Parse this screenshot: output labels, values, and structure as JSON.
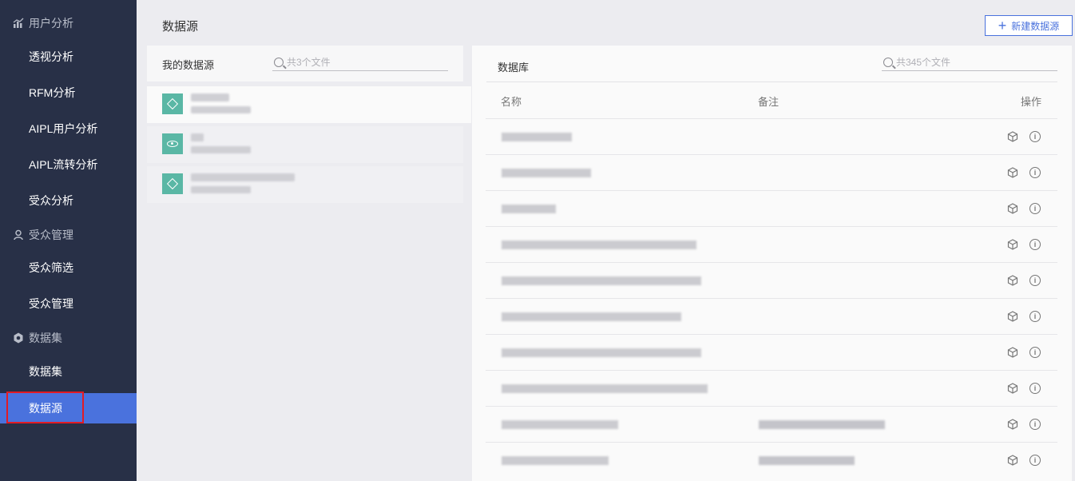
{
  "sidebar": {
    "groups": [
      {
        "label": "用户分析",
        "icon": "bar-chart-icon",
        "items": [
          "透视分析",
          "RFM分析",
          "AIPL用户分析",
          "AIPL流转分析",
          "受众分析"
        ]
      },
      {
        "label": "受众管理",
        "icon": "user-icon",
        "items": [
          "受众筛选",
          "受众管理"
        ]
      },
      {
        "label": "数据集",
        "icon": "hexagon-icon",
        "items": [
          "数据集",
          "数据源"
        ]
      }
    ],
    "active_item": "数据源"
  },
  "header": {
    "title": "数据源",
    "new_button_label": "新建数据源",
    "new_button_icon": "plus-icon"
  },
  "left_panel": {
    "title": "我的数据源",
    "search_placeholder": "共3个文件",
    "items": [
      {
        "name": "■■■■■",
        "meta": "■■■ · ■■",
        "icon": "diamond-icon"
      },
      {
        "name": "■■",
        "meta": "■■■ · ■■",
        "icon": "eye-icon"
      },
      {
        "name": "■■■■■■■■■■■■",
        "meta": "■■■ · ■■",
        "icon": "diamond-icon"
      }
    ]
  },
  "right_panel": {
    "title": "数据库",
    "search_placeholder": "共345个文件",
    "columns": [
      "名称",
      "备注",
      "操作"
    ],
    "rows": [
      {
        "name": "a_trans_detail",
        "remark": ""
      },
      {
        "name": "a_trans_user_detail",
        "remark": ""
      },
      {
        "name": "a_user_info",
        "remark": ""
      },
      {
        "name": "adm_usrs_aaa_trde_cat_mon_cnt_sku_dd",
        "remark": ""
      },
      {
        "name": "adm_usrs_aaa_trde_cat_mon_cnt_mag_dd",
        "remark": ""
      },
      {
        "name": "adm_usrs_aaa_trde_cat_mon_mag_dd",
        "remark": ""
      },
      {
        "name": "adm_usrs_aaa_trde_cat_mon_bran_sku_dd",
        "remark": ""
      },
      {
        "name": "adm_usrs_aaa_trde_cat_mon_bran_mag_dd",
        "remark": ""
      },
      {
        "name": "adm_usrs_aaa_prod_df",
        "remark": "人群数据描述信息说明"
      },
      {
        "name": "adm_usrs_aaa_su_df",
        "remark": "人群数据描述信息"
      }
    ],
    "row_actions": [
      "cube-icon",
      "info-icon"
    ]
  },
  "colors": {
    "sidebar_bg": "#283047",
    "active_bg": "#4a72dd",
    "highlight_border": "#e21b24",
    "tile_green": "#5ab7a5",
    "accent": "#4a72dd"
  }
}
